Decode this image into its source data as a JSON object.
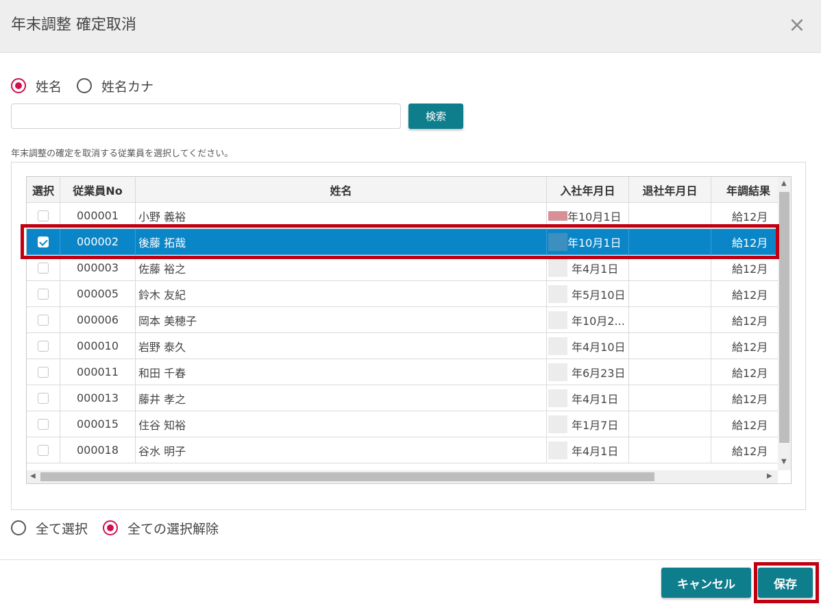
{
  "dialog": {
    "title": "年末調整 確定取消",
    "close_icon": "×"
  },
  "search": {
    "mode_options": [
      {
        "label": "姓名",
        "checked": true
      },
      {
        "label": "姓名カナ",
        "checked": false
      }
    ],
    "input_value": "",
    "button_label": "検索"
  },
  "instruction": "年末調整の確定を取消する従業員を選択してください。",
  "grid": {
    "columns": [
      "選択",
      "従業員No",
      "姓名",
      "入社年月日",
      "退社年月日",
      "年調結果"
    ],
    "rows": [
      {
        "checked": false,
        "no": "000001",
        "name": "小野 義裕",
        "hire_date": "年10月1日",
        "retire_date": "",
        "result": "給12月"
      },
      {
        "checked": true,
        "no": "000002",
        "name": "後藤 拓哉",
        "hire_date": "年10月1日",
        "retire_date": "",
        "result": "給12月"
      },
      {
        "checked": false,
        "no": "000003",
        "name": "佐藤 裕之",
        "hire_date": "年4月1日",
        "retire_date": "",
        "result": "給12月"
      },
      {
        "checked": false,
        "no": "000005",
        "name": "鈴木 友紀",
        "hire_date": "年5月10日",
        "retire_date": "",
        "result": "給12月"
      },
      {
        "checked": false,
        "no": "000006",
        "name": "岡本 美穂子",
        "hire_date": "年10月2...",
        "retire_date": "",
        "result": "給12月"
      },
      {
        "checked": false,
        "no": "000010",
        "name": "岩野 泰久",
        "hire_date": "年4月10日",
        "retire_date": "",
        "result": "給12月"
      },
      {
        "checked": false,
        "no": "000011",
        "name": "和田 千春",
        "hire_date": "年6月23日",
        "retire_date": "",
        "result": "給12月"
      },
      {
        "checked": false,
        "no": "000013",
        "name": "藤井 孝之",
        "hire_date": "年4月1日",
        "retire_date": "",
        "result": "給12月"
      },
      {
        "checked": false,
        "no": "000015",
        "name": "住谷 知裕",
        "hire_date": "年1月7日",
        "retire_date": "",
        "result": "給12月"
      },
      {
        "checked": false,
        "no": "000018",
        "name": "谷水 明子",
        "hire_date": "年4月1日",
        "retire_date": "",
        "result": "給12月"
      }
    ],
    "selected_row_index": 1
  },
  "bulk_select": {
    "options": [
      {
        "label": "全て選択",
        "checked": false
      },
      {
        "label": "全ての選択解除",
        "checked": true
      }
    ]
  },
  "footer": {
    "cancel_label": "キャンセル",
    "save_label": "保存"
  },
  "colors": {
    "accent_teal": "#0e7d8c",
    "radio_checked": "#d0104c",
    "row_selected": "#0a86c8",
    "highlight_red": "#c00010"
  }
}
